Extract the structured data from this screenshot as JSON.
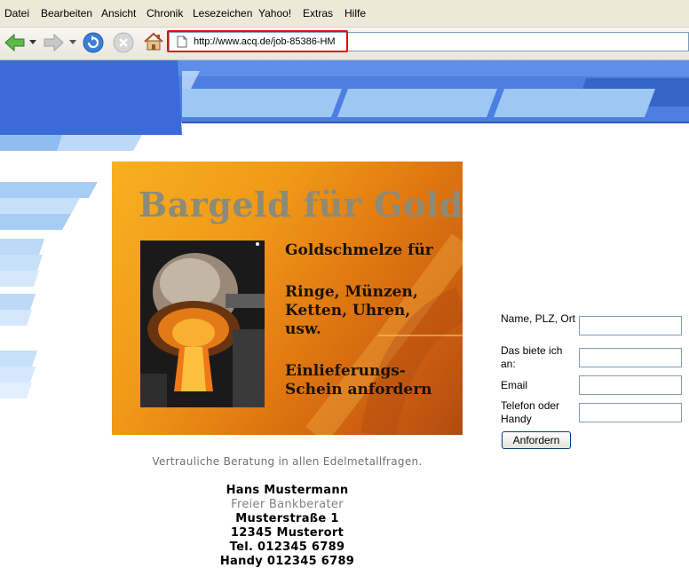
{
  "menu": [
    "Datei",
    "Bearbeiten",
    "Ansicht",
    "Chronik",
    "Lesezeichen",
    "Yahoo!",
    "Extras",
    "Hilfe"
  ],
  "address": {
    "url": "http://www.acq.de/job-85386-HM"
  },
  "icons": {
    "back": "back-arrow-icon",
    "forward": "forward-arrow-icon",
    "reload": "reload-icon",
    "stop": "stop-icon",
    "home": "home-icon",
    "page": "page-icon"
  },
  "ad": {
    "title": "Bargeld für Gold",
    "line1": "Goldschmelze für",
    "line2": "Ringe, Münzen,",
    "line3": "Ketten, Uhren,",
    "line4": "usw.",
    "line5": "Einlieferungs-",
    "line6": "Schein anfordern"
  },
  "form": {
    "name_label": "Name, PLZ, Ort",
    "offer_label": "Das biete ich an:",
    "email_label": "Email",
    "phone_label": "Telefon oder Handy",
    "name_value": "",
    "offer_value": "",
    "email_value": "",
    "phone_value": "",
    "submit_label": "Anfordern"
  },
  "contact": {
    "tagline": "Vertrauliche Beratung in allen Edelmetallfragen.",
    "name": "Hans Mustermann",
    "role": "Freier Bankberater",
    "street": "Musterstraße 1",
    "city": "12345 Musterort",
    "tel": "Tel. 012345 6789",
    "mobile": "Handy 012345 6789"
  },
  "colors": {
    "banner_blue": "#3a6fd6",
    "banner_light": "#9ec8f4",
    "highlight": "#e01010"
  }
}
